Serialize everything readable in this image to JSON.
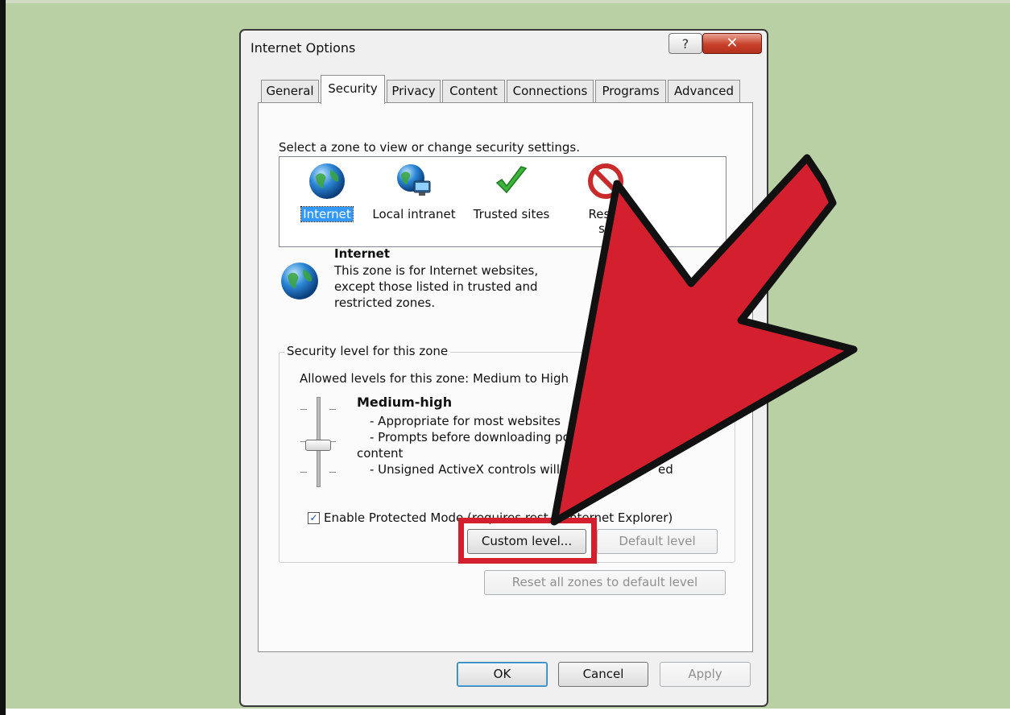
{
  "window": {
    "title": "Internet Options",
    "help_glyph": "?",
    "close_glyph": "✕"
  },
  "tabs": [
    {
      "label": "General"
    },
    {
      "label": "Security"
    },
    {
      "label": "Privacy"
    },
    {
      "label": "Content"
    },
    {
      "label": "Connections"
    },
    {
      "label": "Programs"
    },
    {
      "label": "Advanced"
    }
  ],
  "security": {
    "zone_prompt": "Select a zone to view or change security settings.",
    "zones": [
      {
        "label": "Internet",
        "icon": "globe-icon",
        "selected": true
      },
      {
        "label": "Local intranet",
        "icon": "network-globe-icon",
        "selected": false
      },
      {
        "label": "Trusted sites",
        "icon": "green-check-icon",
        "selected": false
      },
      {
        "label": "Restri",
        "label_line2": "sit",
        "icon": "no-entry-icon",
        "selected": false
      }
    ],
    "selected_zone": {
      "title": "Internet",
      "description": "This zone is for Internet websites, except those listed in trusted and restricted zones."
    },
    "group_title": "Security level for this zone",
    "allowed_levels": "Allowed levels for this zone: Medium to High",
    "level": {
      "name": "Medium-high",
      "bullets": [
        "- Appropriate for most websites",
        "- Prompts before downloading po",
        "content",
        "- Unsigned ActiveX controls will"
      ],
      "partial_trailing": "ed"
    },
    "protected_mode": {
      "checked": true,
      "label_before": "Enable Protected Mode (requires rest",
      "label_after": "Internet Explorer)"
    },
    "buttons": {
      "custom_level": "Custom level...",
      "default_level": "Default level",
      "reset_all": "Reset all zones to default level"
    }
  },
  "footer": {
    "ok": "OK",
    "cancel": "Cancel",
    "apply": "Apply"
  },
  "colors": {
    "background": "#b9d0a4",
    "arrow_fill": "#d4202e",
    "highlight_box": "#d4202e",
    "selection": "#3399ff"
  }
}
